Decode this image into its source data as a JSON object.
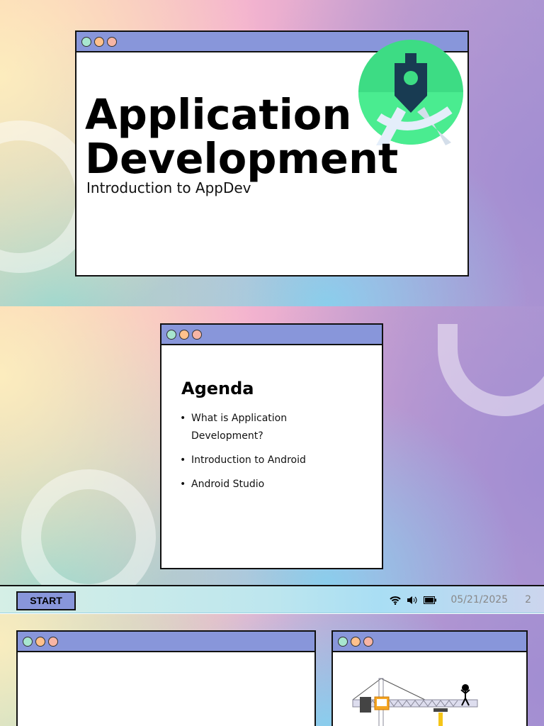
{
  "slide1": {
    "title_line1": "Application",
    "title_line2": "Development",
    "subtitle": "Introduction to AppDev",
    "logo": "android-studio-logo"
  },
  "slide2": {
    "heading": "Agenda",
    "items": [
      "What is Application Development?",
      "Introduction to Android",
      "Android Studio"
    ]
  },
  "taskbar": {
    "start_label": "START",
    "date": "05/21/2025",
    "page": "2",
    "icons": [
      "wifi-icon",
      "volume-icon",
      "battery-icon"
    ]
  },
  "colors": {
    "titlebar": "#8896da",
    "logo_green": "#3ddc84"
  }
}
